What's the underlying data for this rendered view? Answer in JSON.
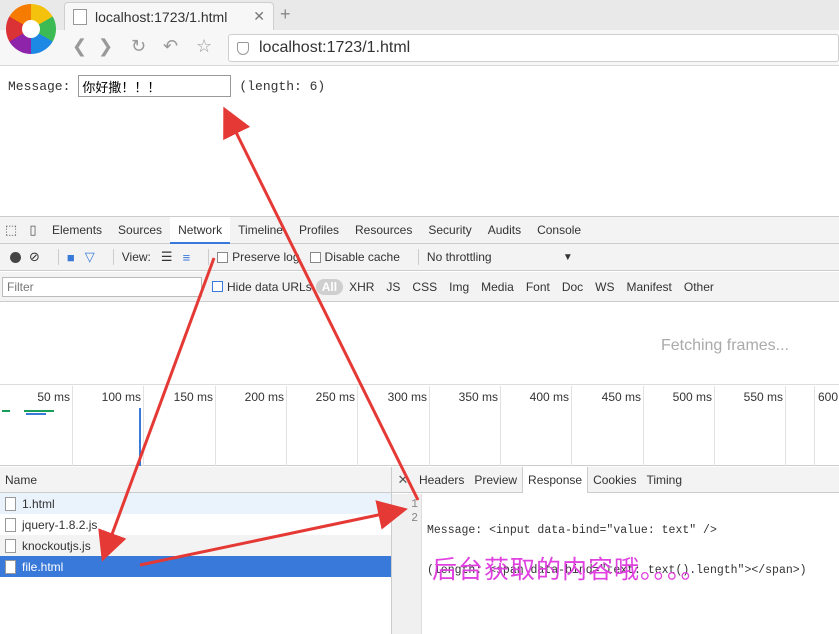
{
  "browser": {
    "tab_title": "localhost:1723/1.html",
    "address": "localhost:1723/1.html"
  },
  "page": {
    "message_label": "Message:",
    "message_value": "你好撒！！！",
    "length_text": "(length: 6)"
  },
  "devtools": {
    "tabs": [
      "Elements",
      "Sources",
      "Network",
      "Timeline",
      "Profiles",
      "Resources",
      "Security",
      "Audits",
      "Console"
    ],
    "active_tab": "Network",
    "controls": {
      "view_label": "View:",
      "preserve_log": "Preserve log",
      "disable_cache": "Disable cache",
      "throttling": "No throttling"
    },
    "filter": {
      "placeholder": "Filter",
      "hide_data_urls": "Hide data URLs",
      "types": [
        "All",
        "XHR",
        "JS",
        "CSS",
        "Img",
        "Media",
        "Font",
        "Doc",
        "WS",
        "Manifest",
        "Other"
      ]
    },
    "fetching_text": "Fetching frames...",
    "timeline_ticks": [
      "50 ms",
      "100 ms",
      "150 ms",
      "200 ms",
      "250 ms",
      "300 ms",
      "350 ms",
      "400 ms",
      "450 ms",
      "500 ms",
      "550 ms",
      "600"
    ],
    "name_header": "Name",
    "files": [
      "1.html",
      "jquery-1.8.2.js",
      "knockoutjs.js",
      "file.html"
    ],
    "selected_file": "file.html",
    "response_tabs": [
      "Headers",
      "Preview",
      "Response",
      "Cookies",
      "Timing"
    ],
    "active_response_tab": "Response",
    "code_lines": [
      {
        "num": "1",
        "text": "Message: <input data-bind=\"value: text\" />"
      },
      {
        "num": "2",
        "text": "(length: <span data-bind=\"text: text().length\"></span>)"
      }
    ]
  },
  "annotation": {
    "note": "后台获取的内容哦。。。。",
    "arrow_color": "#e53935"
  }
}
